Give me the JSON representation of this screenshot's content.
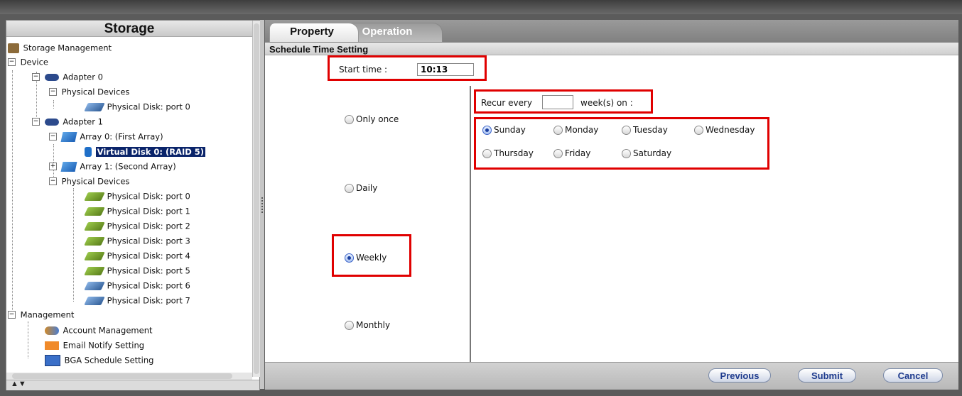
{
  "sidebar": {
    "title": "Storage",
    "items": [
      {
        "label": "Storage Management",
        "icon": "storage-management-icon"
      },
      {
        "label": "Device"
      },
      {
        "label": "Adapter 0",
        "icon": "lacie-adapter-icon"
      },
      {
        "label": "Physical Devices"
      },
      {
        "label": "Physical Disk: port 0",
        "icon": "physical-disk-icon"
      },
      {
        "label": "Adapter 1",
        "icon": "lacie-adapter-icon"
      },
      {
        "label": "Array 0: (First Array)",
        "icon": "array-icon"
      },
      {
        "label": "Virtual Disk 0: (RAID 5)",
        "icon": "virtual-disk-icon",
        "selected": true
      },
      {
        "label": "Array 1: (Second Array)",
        "icon": "array-icon"
      },
      {
        "label": "Physical Devices"
      },
      {
        "label": "Physical Disk: port 0",
        "icon": "physical-disk-icon"
      },
      {
        "label": "Physical Disk: port 1",
        "icon": "physical-disk-icon"
      },
      {
        "label": "Physical Disk: port 2",
        "icon": "physical-disk-icon"
      },
      {
        "label": "Physical Disk: port 3",
        "icon": "physical-disk-icon"
      },
      {
        "label": "Physical Disk: port 4",
        "icon": "physical-disk-icon"
      },
      {
        "label": "Physical Disk: port 5",
        "icon": "physical-disk-icon"
      },
      {
        "label": "Physical Disk: port 6",
        "icon": "physical-disk-icon"
      },
      {
        "label": "Physical Disk: port 7",
        "icon": "physical-disk-icon"
      },
      {
        "label": "Management"
      },
      {
        "label": "Account Management",
        "icon": "account-icon"
      },
      {
        "label": "Email Notify Setting",
        "icon": "email-icon"
      },
      {
        "label": "BGA Schedule Setting",
        "icon": "calendar-icon"
      }
    ]
  },
  "tabs": {
    "property": "Property",
    "operation": "Operation"
  },
  "section_title": "Schedule Time Setting",
  "start_time": {
    "label": "Start time :",
    "value": "10:13"
  },
  "frequency": {
    "only_once": "Only once",
    "daily": "Daily",
    "weekly": "Weekly",
    "monthly": "Monthly",
    "selected": "Weekly"
  },
  "recur": {
    "prefix": "Recur every",
    "value": "",
    "suffix": "week(s) on :"
  },
  "days": {
    "sunday": "Sunday",
    "monday": "Monday",
    "tuesday": "Tuesday",
    "wednesday": "Wednesday",
    "thursday": "Thursday",
    "friday": "Friday",
    "saturday": "Saturday",
    "selected": "Sunday"
  },
  "buttons": {
    "previous": "Previous",
    "submit": "Submit",
    "cancel": "Cancel"
  },
  "colors": {
    "highlight_box": "#e00000",
    "selection": "#0a246a",
    "button_text": "#1f3c8e"
  }
}
